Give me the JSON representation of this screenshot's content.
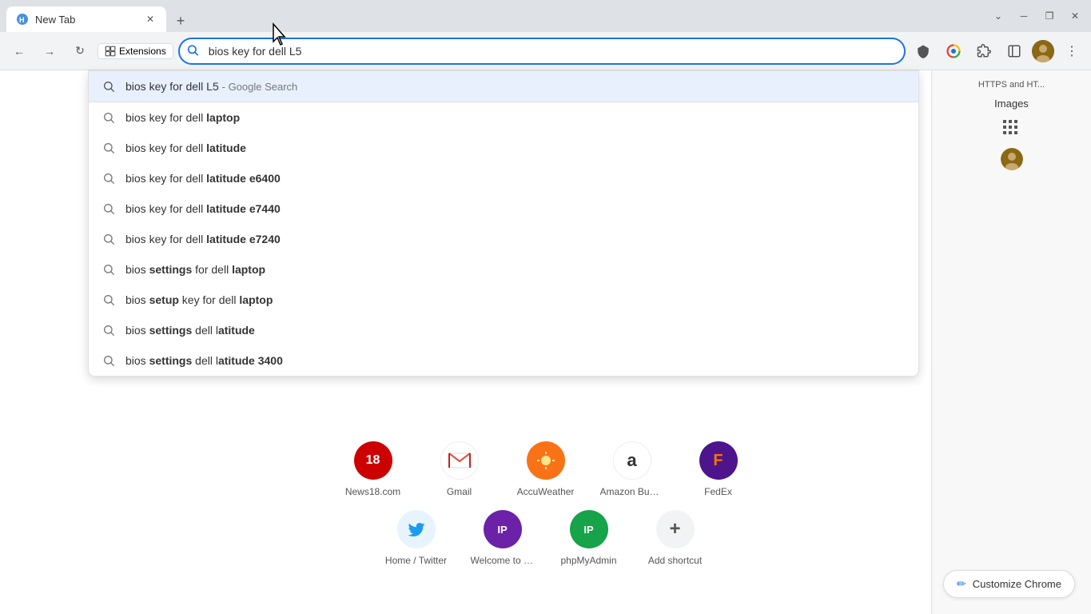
{
  "browser": {
    "tab_title": "New Tab",
    "new_tab_btn": "+",
    "close_btn": "✕",
    "minimize_btn": "─",
    "maximize_btn": "❐",
    "titlebar_close": "✕"
  },
  "toolbar": {
    "back_btn": "←",
    "forward_btn": "→",
    "refresh_btn": "↻",
    "omnibox_value": "bios key for dell L5",
    "extensions_label": "Extensions",
    "right_panel_text": "HTTPS and HT...",
    "images_label": "Images",
    "more_btn": "⋮"
  },
  "autocomplete": {
    "first_item": {
      "text": "bios key for dell L5",
      "suffix": " - Google Search"
    },
    "suggestions": [
      {
        "normal": "bios key for dell ",
        "bold": "laptop"
      },
      {
        "normal": "bios key for dell ",
        "bold": "latitude"
      },
      {
        "normal": "bios key for dell ",
        "bold": "latitude e6400"
      },
      {
        "normal": "bios key for dell ",
        "bold": "latitude e7440"
      },
      {
        "normal": "bios key for dell ",
        "bold": "latitude e7240"
      },
      {
        "normal": "bios ",
        "bold": "settings",
        "suffix": " for dell ",
        "bold2": "laptop"
      },
      {
        "normal": "bios ",
        "bold": "setup",
        "suffix": " key for dell ",
        "bold2": "laptop"
      },
      {
        "normal": "bios ",
        "bold": "settings",
        "suffix": " dell l",
        "bold2": "atitude"
      },
      {
        "normal": "bios ",
        "bold": "settings",
        "suffix": " dell l",
        "bold2": "atitude 3400"
      }
    ]
  },
  "top_sites_row1": [
    {
      "label": "News18.com",
      "bg": "#cc0000",
      "color": "#fff",
      "text": "18"
    },
    {
      "label": "Gmail",
      "bg": "#fff",
      "color": "#333",
      "text": "M"
    },
    {
      "label": "AccuWeather",
      "bg": "#f97316",
      "color": "#fff",
      "text": "☀"
    },
    {
      "label": "Amazon Busi...",
      "bg": "#fff",
      "color": "#333",
      "text": "a"
    },
    {
      "label": "FedEx",
      "bg": "#4d148c",
      "color": "#fa7600",
      "text": "F"
    }
  ],
  "top_sites_row2": [
    {
      "label": "Home / Twitter",
      "bg": "#e8f4fd",
      "color": "#1d9bf0",
      "text": "🐦"
    },
    {
      "label": "Welcome to n...",
      "bg": "#6b21a8",
      "color": "#fff",
      "text": "IP"
    },
    {
      "label": "phpMyAdmin",
      "bg": "#16a34a",
      "color": "#fff",
      "text": "IP"
    },
    {
      "label": "Add shortcut",
      "bg": "#f1f3f4",
      "color": "#555",
      "text": "+"
    }
  ],
  "customize": {
    "btn_label": "Customize Chrome",
    "btn_icon": "✏"
  }
}
